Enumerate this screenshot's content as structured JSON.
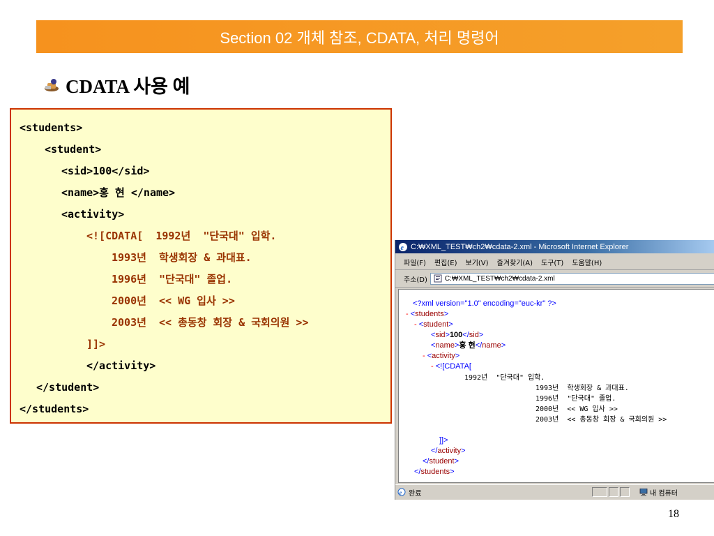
{
  "title": "Section 02 개체 참조, CDATA, 처리 명령어",
  "heading": "CDATA 사용 예",
  "code_lines": [
    "<students>",
    "<student>",
    "<sid>100</sid>",
    "<name>홍 현 </name>",
    "<activity>",
    "<![CDATA[  1992년  \"단국대\" 입학.",
    "1993년  학생회장 & 과대표.",
    "1996년  \"단국대\" 졸업.",
    "2000년  << WG 입사 >>",
    "2003년  << 총동창 회장 & 국회의원 >>",
    "]]>",
    "</activity>",
    "</student>",
    "</students>"
  ],
  "browser": {
    "title": "C:₩XML_TEST₩ch2₩cdata-2.xml - Microsoft Internet Explorer",
    "menu": [
      "파일(F)",
      "편집(E)",
      "보기(V)",
      "즐겨찾기(A)",
      "도구(T)",
      "도움말(H)"
    ],
    "address_label": "주소(D)",
    "address_value": "C:₩XML_TEST₩ch2₩cdata-2.xml",
    "xml": {
      "pi": "<?xml version=\"1.0\" encoding=\"euc-kr\" ?>",
      "minus": "-",
      "students_open": "students",
      "student_open": "student",
      "sid_tag": "sid",
      "sid_value": "100",
      "name_tag": "name",
      "name_value": "홍 현",
      "activity_tag": "activity",
      "cdata_open": "<![CDATA[",
      "cdata_lines": [
        "1992년  \"단국대\" 입학.",
        "1993년  학생회장 & 과대표.",
        "1996년  \"단국대\" 졸업.",
        "2000년  << WG 입사 >>",
        "2003년  << 총동창 회장 & 국회의원 >>"
      ],
      "cdata_close": "]]>"
    },
    "status_text": "완료",
    "zone_text": "내 컴퓨터"
  },
  "page_number": "18"
}
